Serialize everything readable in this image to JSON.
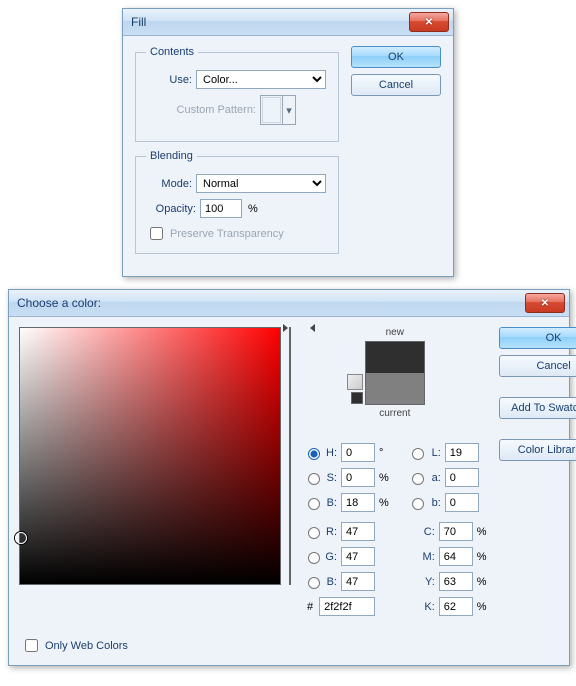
{
  "fill": {
    "title": "Fill",
    "contents_legend": "Contents",
    "use_label": "Use:",
    "use_value": "Color...",
    "custom_pattern_label": "Custom Pattern:",
    "blending_legend": "Blending",
    "mode_label": "Mode:",
    "mode_value": "Normal",
    "opacity_label": "Opacity:",
    "opacity_value": "100",
    "opacity_unit": "%",
    "preserve_label": "Preserve Transparency",
    "ok": "OK",
    "cancel": "Cancel"
  },
  "picker": {
    "title": "Choose a color:",
    "ok": "OK",
    "cancel": "Cancel",
    "add_swatches": "Add To Swatches",
    "color_libraries": "Color Libraries",
    "new_label": "new",
    "current_label": "current",
    "new_color": "#2f2f2f",
    "current_color": "#808080",
    "only_web": "Only Web Colors",
    "fields": {
      "H": {
        "label": "H:",
        "value": "0",
        "unit": "°"
      },
      "S": {
        "label": "S:",
        "value": "0",
        "unit": "%"
      },
      "Bv": {
        "label": "B:",
        "value": "18",
        "unit": "%"
      },
      "R": {
        "label": "R:",
        "value": "47",
        "unit": ""
      },
      "G": {
        "label": "G:",
        "value": "47",
        "unit": ""
      },
      "Bc": {
        "label": "B:",
        "value": "47",
        "unit": ""
      },
      "L": {
        "label": "L:",
        "value": "19",
        "unit": ""
      },
      "a": {
        "label": "a:",
        "value": "0",
        "unit": ""
      },
      "b": {
        "label": "b:",
        "value": "0",
        "unit": ""
      },
      "C": {
        "label": "C:",
        "value": "70",
        "unit": "%"
      },
      "M": {
        "label": "M:",
        "value": "64",
        "unit": "%"
      },
      "Y": {
        "label": "Y:",
        "value": "63",
        "unit": "%"
      },
      "K": {
        "label": "K:",
        "value": "62",
        "unit": "%"
      }
    },
    "hex_label": "#",
    "hex_value": "2f2f2f"
  }
}
